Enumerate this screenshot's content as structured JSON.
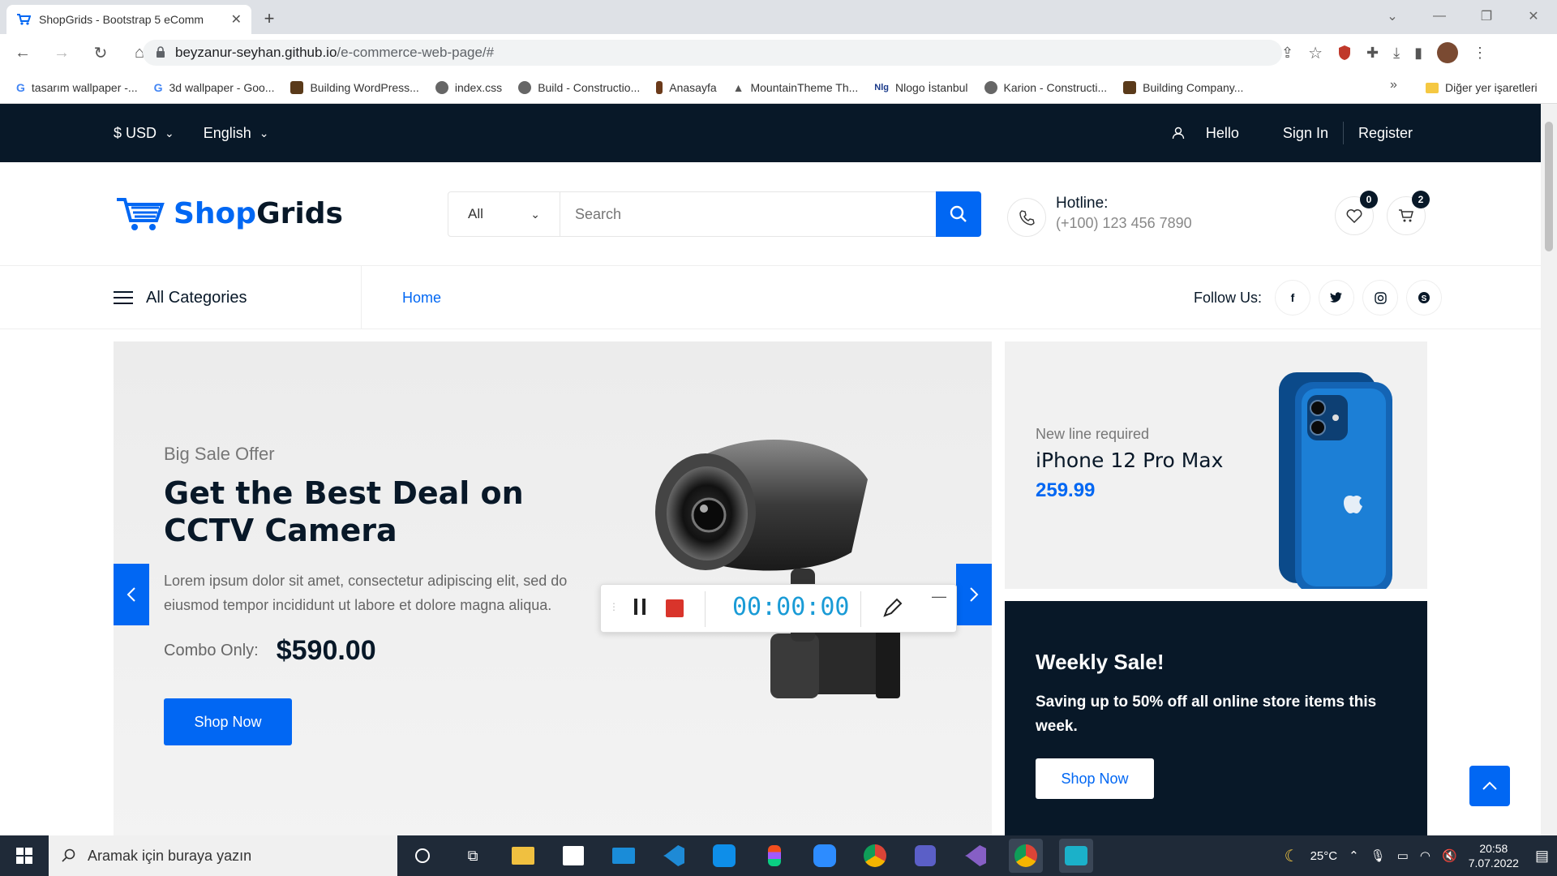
{
  "browser": {
    "tab_title": "ShopGrids - Bootstrap 5 eComm",
    "url_host": "beyzanur-seyhan.github.io",
    "url_path": "/e-commerce-web-page/#",
    "bookmarks": [
      "tasarım wallpaper -...",
      "3d wallpaper - Goo...",
      "Building WordPress...",
      "index.css",
      "Build - Constructio...",
      "Anasayfa",
      "MountainTheme Th...",
      "Nlogo İstanbul",
      "Karion - Constructi...",
      "Building Company..."
    ],
    "bookmarks_more": "»",
    "other_bookmarks": "Diğer yer işaretleri"
  },
  "topbar": {
    "currency": "$ USD",
    "language": "English",
    "hello": "Hello",
    "sign_in": "Sign In",
    "register": "Register"
  },
  "header": {
    "logo_part1": "Shop",
    "logo_part2": "Grids",
    "search_category": "All",
    "search_placeholder": "Search",
    "hotline_label": "Hotline:",
    "hotline_number": "(+100) 123 456 7890",
    "wishlist_count": "0",
    "cart_count": "2"
  },
  "nav": {
    "all_categories": "All Categories",
    "home": "Home",
    "follow_us": "Follow Us:"
  },
  "hero": {
    "subtitle": "Big Sale Offer",
    "title": "Get the Best Deal on CCTV Camera",
    "description": "Lorem ipsum dolor sit amet, consectetur adipiscing elit, sed do eiusmod tempor incididunt ut labore et dolore magna aliqua.",
    "combo_label": "Combo Only:",
    "price": "$590.00",
    "button": "Shop Now"
  },
  "recorder": {
    "time": "00:00:00"
  },
  "promo_phone": {
    "subtitle": "New line required",
    "name": "iPhone 12 Pro Max",
    "price": "259.99"
  },
  "promo_weekly": {
    "title": "Weekly Sale!",
    "description": "Saving up to 50% off all online store items this week.",
    "button": "Shop Now"
  },
  "taskbar": {
    "search_placeholder": "Aramak için buraya yazın",
    "temperature": "25°C",
    "time": "20:58",
    "date": "7.07.2022"
  },
  "colors": {
    "brand_blue": "#0167f3",
    "dark_navy": "#081828"
  }
}
